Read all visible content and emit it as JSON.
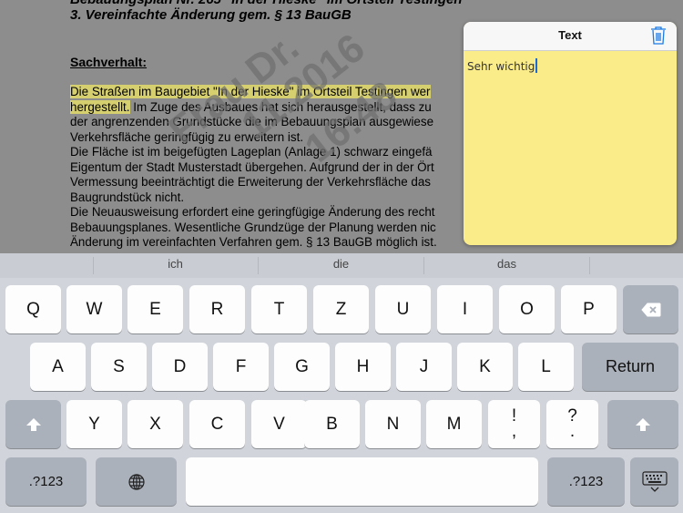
{
  "document": {
    "title_line_1": "Bebauungsplan Nr. 265 \"In der Hieske\" im Ortsteil Testingen",
    "title_line_2": "3. Vereinfachte Änderung gem. § 13 BauGB",
    "heading": "Sachverhalt:",
    "highlight_1": "Die Straßen im Baugebiet \"In der Hieske\" im Ortsteil Testingen wer",
    "highlight_2": "hergestellt.",
    "body_line_2_rest": " Im Zuge des Ausbaues hat sich herausgestellt, dass zu",
    "body_line_3": "der angrenzenden Grundstücke die im Bebauungsplan ausgewiese",
    "body_line_4": "Verkehrsfläche geringfügig zu erweitern ist.",
    "body_line_5": "Die Fläche ist im beigefügten Lageplan (Anlage 1) schwarz eingefä",
    "body_line_6": "Eigentum der Stadt Musterstadt übergehen. Aufgrund der in der Ört",
    "body_line_7": "Vermessung beeinträchtigt die Erweiterung der Verkehrsfläche das",
    "body_line_8": "Baugrundstück nicht.",
    "body_line_9": "Die Neuausweisung erfordert eine geringfügige Änderung des recht",
    "body_line_10": "Bebauungsplanes. Wesentliche Grundzüge der Planung werden nic",
    "body_line_11": "Änderung im vereinfachten Verfahren gem. § 13 BauGB möglich ist.",
    "watermark_1": "Frau Dr.",
    "watermark_2": "11.2016",
    "watermark_3": "16:48"
  },
  "note": {
    "title": "Text",
    "content": "Sehr wichtig",
    "icons": {
      "delete": "trash-icon"
    },
    "accent": "#1a7ae6",
    "background": "#fbec8a"
  },
  "keyboard": {
    "predictions": [
      "ich",
      "die",
      "das"
    ],
    "row1": [
      "Q",
      "W",
      "E",
      "R",
      "T",
      "Z",
      "U",
      "I",
      "O",
      "P"
    ],
    "row2": [
      "A",
      "S",
      "D",
      "F",
      "G",
      "H",
      "J",
      "K",
      "L"
    ],
    "return_label": "Return",
    "row3": [
      "Y",
      "X",
      "C",
      "V",
      "B",
      "N",
      "M"
    ],
    "punct_1_top": "!",
    "punct_1_bottom": ",",
    "punct_2_top": "?",
    "punct_2_bottom": ".",
    "numbers_label": ".?123",
    "icons": {
      "backspace": "backspace-icon",
      "shift": "shift-icon",
      "globe": "globe-icon",
      "dismiss": "keyboard-dismiss-icon"
    }
  }
}
